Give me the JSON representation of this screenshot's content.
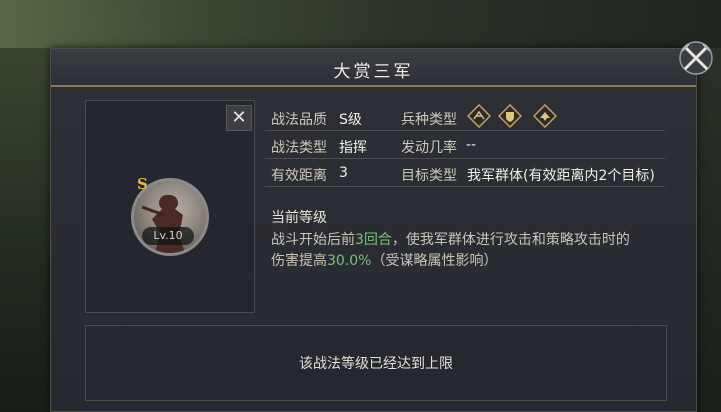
{
  "dialog": {
    "title": "大赏三军"
  },
  "tactic_card": {
    "grade": "S",
    "level": "Lv.10"
  },
  "attributes": {
    "quality_label": "战法品质",
    "quality_value": "S级",
    "type_label": "战法类型",
    "type_value": "指挥",
    "range_label": "有效距离",
    "range_value": "3",
    "troop_label": "兵种类型",
    "troop_icons": [
      "cavalry-icon",
      "shield-icon",
      "archer-icon"
    ],
    "chance_label": "发动几率",
    "chance_value": "--",
    "target_label": "目标类型",
    "target_value": "我军群体(有效距离内2个目标)"
  },
  "level_section": {
    "title": "当前等级",
    "desc_part1": "战斗开始后前",
    "desc_rounds": "3回合",
    "desc_part2": "，使我军群体进行攻击和策略攻击时的",
    "desc_part3": "伤害提高",
    "desc_percent": "30.0%",
    "desc_part4": "（受谋略属性影响）"
  },
  "footer": {
    "max_level_text": "该战法等级已经达到上限"
  },
  "colors": {
    "highlight_green": "#7ac07a",
    "grade_gold": "#e1b64d",
    "title_underline": "#8d7a4e"
  }
}
